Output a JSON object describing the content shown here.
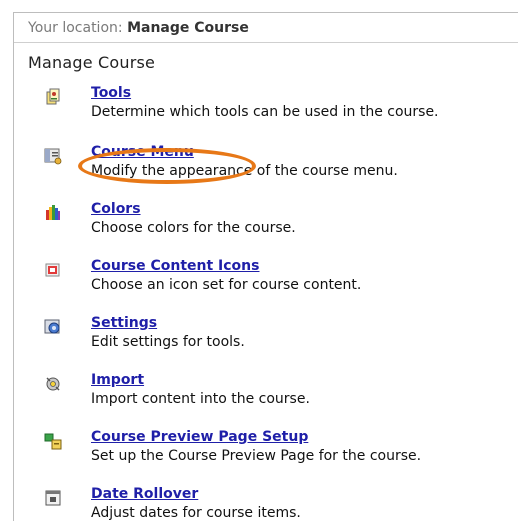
{
  "location": {
    "label": "Your location:",
    "value": "Manage Course"
  },
  "page_title": "Manage Course",
  "items": [
    {
      "label": "Tools",
      "description": "Determine which tools can be used in the course.",
      "icon": "tools-icon"
    },
    {
      "label": "Course Menu",
      "description": "Modify the appearance of the course menu.",
      "icon": "course-menu-icon"
    },
    {
      "label": "Colors",
      "description": "Choose colors for the course.",
      "icon": "colors-icon"
    },
    {
      "label": "Course Content Icons",
      "description": "Choose an icon set for course content.",
      "icon": "content-icons-icon"
    },
    {
      "label": "Settings",
      "description": "Edit settings for tools.",
      "icon": "settings-icon"
    },
    {
      "label": "Import",
      "description": "Import content into the course.",
      "icon": "import-icon"
    },
    {
      "label": "Course Preview Page Setup",
      "description": "Set up the Course Preview Page for the course.",
      "icon": "preview-setup-icon"
    },
    {
      "label": "Date Rollover",
      "description": "Adjust dates for course items.",
      "icon": "date-rollover-icon"
    }
  ],
  "colors": {
    "link": "#1f1fa8",
    "highlight": "#e77817"
  }
}
